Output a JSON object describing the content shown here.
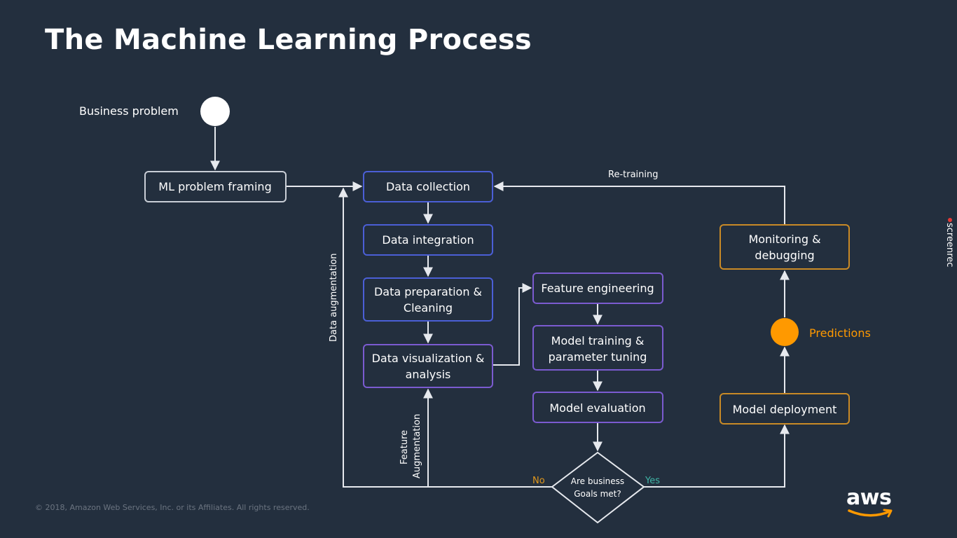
{
  "slide": {
    "title": "The Machine Learning Process",
    "copyright": "© 2018, Amazon Web Services, Inc. or its Affiliates. All rights reserved.",
    "logo_text": "aws",
    "watermark": "screenrec"
  },
  "diagram": {
    "start_label": "Business problem",
    "nodes": {
      "ml_problem_framing": "ML problem framing",
      "data_collection": "Data collection",
      "data_integration": "Data integration",
      "data_preparation_1": "Data preparation &",
      "data_preparation_2": "Cleaning",
      "data_visualization_1": "Data visualization &",
      "data_visualization_2": "analysis",
      "feature_engineering": "Feature engineering",
      "model_training_1": "Model training &",
      "model_training_2": "parameter tuning",
      "model_evaluation": "Model evaluation",
      "decision_1": "Are business",
      "decision_2": "Goals met?",
      "model_deployment": "Model deployment",
      "predictions": "Predictions",
      "monitoring_1": "Monitoring &",
      "monitoring_2": "debugging"
    },
    "edge_labels": {
      "retraining": "Re-training",
      "data_augmentation": "Data augmentation",
      "feature_augmentation_1": "Feature",
      "feature_augmentation_2": "Augmentation",
      "no": "No",
      "yes": "Yes"
    },
    "colors": {
      "background": "#232f3e",
      "start_circle": "#ffffff",
      "predictions_circle": "#ff9900",
      "no_label": "#e0971c",
      "yes_label": "#3fb5a6",
      "data_boxes": "#4b5fd6",
      "model_boxes": "#7b5bd0",
      "deploy_boxes": "#c98a26",
      "framing_box": "#c9ced6"
    }
  }
}
